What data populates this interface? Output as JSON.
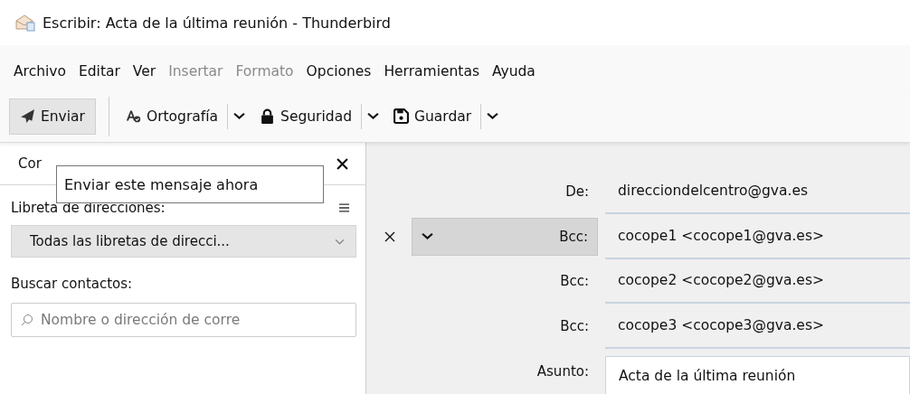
{
  "window": {
    "title": "Escribir: Acta de la última reunión - Thunderbird"
  },
  "menu": [
    {
      "label": "Archivo",
      "disabled": false
    },
    {
      "label": "Editar",
      "disabled": false
    },
    {
      "label": "Ver",
      "disabled": false
    },
    {
      "label": "Insertar",
      "disabled": true
    },
    {
      "label": "Formato",
      "disabled": true
    },
    {
      "label": "Opciones",
      "disabled": false
    },
    {
      "label": "Herramientas",
      "disabled": false
    },
    {
      "label": "Ayuda",
      "disabled": false
    }
  ],
  "toolbar": [
    {
      "label": "Enviar",
      "kind": "send"
    },
    {
      "label": "Ortografía",
      "kind": "spelling"
    },
    {
      "label": "Seguridad",
      "kind": "security"
    },
    {
      "label": "Guardar",
      "kind": "save"
    }
  ],
  "tooltip": "Enviar este mensaje ahora",
  "contacts_pane": {
    "tab_label": "Cor",
    "address_book_label": "Libreta de direcciones:",
    "address_book_value": "Todas las libretas de direcci...",
    "search_label": "Buscar contactos:",
    "search_placeholder": "Nombre o dirección de corre"
  },
  "header": {
    "from": {
      "label": "De:",
      "value": "direcciondelcentro@gva.es"
    },
    "recipients": [
      {
        "label": "Bcc:",
        "value": "cocope1 <cocope1@gva.es>",
        "selected": true
      },
      {
        "label": "Bcc:",
        "value": "cocope2 <cocope2@gva.es>",
        "selected": false
      },
      {
        "label": "Bcc:",
        "value": "cocope3 <cocope3@gva.es>",
        "selected": false
      }
    ],
    "subject": {
      "label": "Asunto:",
      "value": "Acta de la última reunión"
    }
  }
}
